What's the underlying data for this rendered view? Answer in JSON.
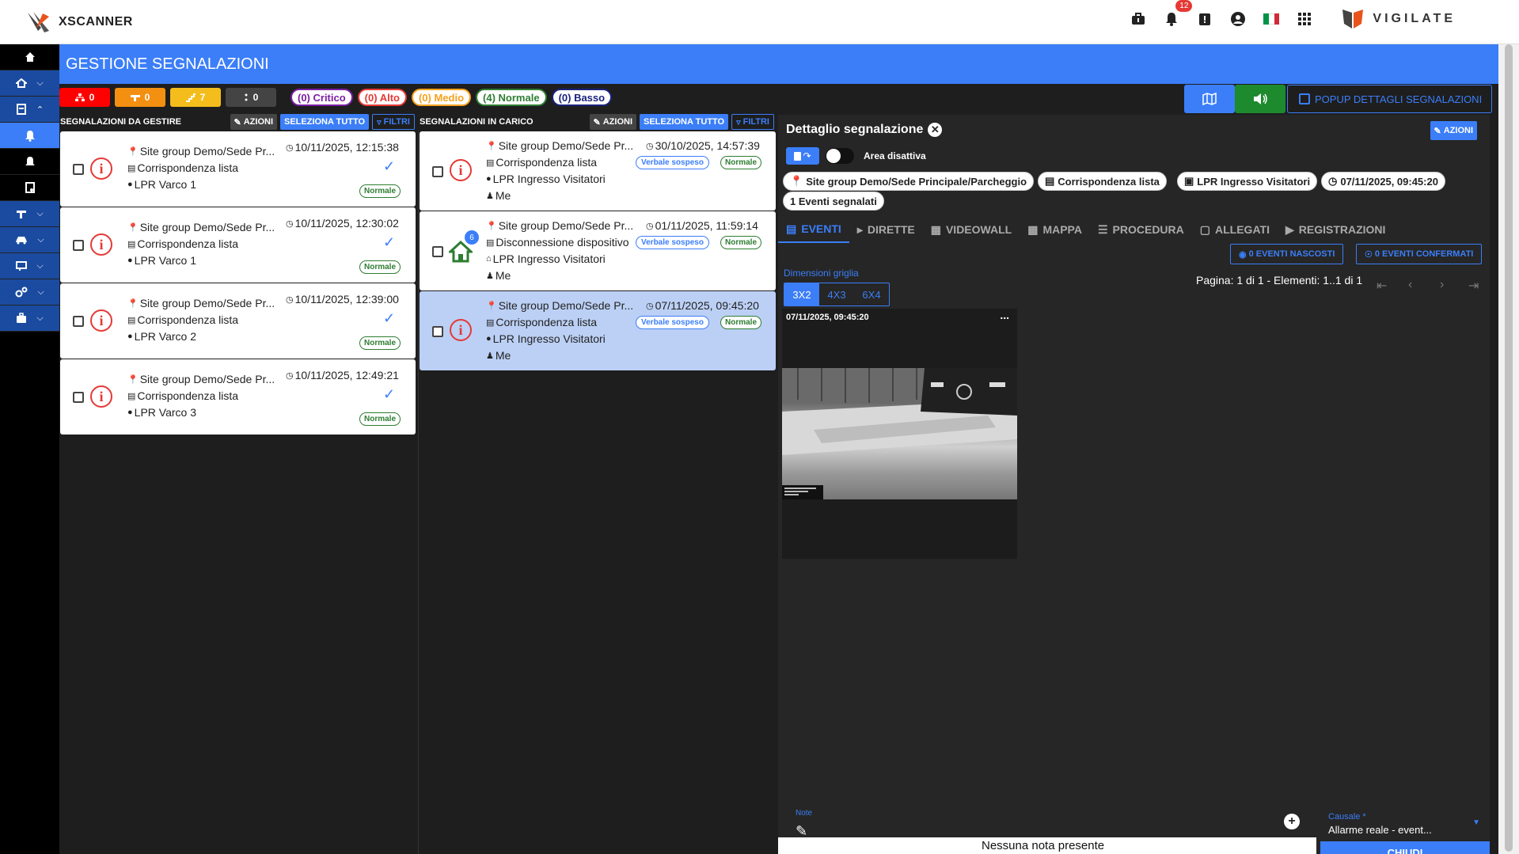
{
  "app": {
    "name": "XSCANNER",
    "brand": "VIGILATE",
    "notification_count": "12"
  },
  "page": {
    "title": "GESTIONE SEGNALAZIONI"
  },
  "severity_counts": [
    {
      "value": "0",
      "color": "#ff0000"
    },
    {
      "value": "0",
      "color": "#f39011"
    },
    {
      "value": "7",
      "color": "#f4bd1c"
    },
    {
      "value": "0",
      "color": "#444444"
    }
  ],
  "filter_pills": [
    {
      "label": "(0) Critico",
      "color": "#7b1fa2"
    },
    {
      "label": "(0) Alto",
      "color": "#e53935"
    },
    {
      "label": "(0) Medio",
      "color": "#f4a21c"
    },
    {
      "label": "(4) Normale",
      "color": "#2e7d32"
    },
    {
      "label": "(0) Basso",
      "color": "#1a237e"
    }
  ],
  "toolbar": {
    "popup_label": "POPUP DETTAGLI SEGNALAZIONI"
  },
  "col_left": {
    "title": "SEGNALAZIONI DA GESTIRE",
    "azioni": "AZIONI",
    "seleziona": "SELEZIONA TUTTO",
    "filtri": "FILTRI",
    "cards": [
      {
        "site": "Site group Demo/Sede Pr...",
        "date": "10/11/2025, 12:15:38",
        "type": "Corrispondenza lista",
        "gate": "LPR Varco 1",
        "priority": "Normale"
      },
      {
        "site": "Site group Demo/Sede Pr...",
        "date": "10/11/2025, 12:30:02",
        "type": "Corrispondenza lista",
        "gate": "LPR Varco 1",
        "priority": "Normale"
      },
      {
        "site": "Site group Demo/Sede Pr...",
        "date": "10/11/2025, 12:39:00",
        "type": "Corrispondenza lista",
        "gate": "LPR Varco 2",
        "priority": "Normale"
      },
      {
        "site": "Site group Demo/Sede Pr...",
        "date": "10/11/2025, 12:49:21",
        "type": "Corrispondenza lista",
        "gate": "LPR Varco 3",
        "priority": "Normale"
      }
    ]
  },
  "col_mid": {
    "title": "SEGNALAZIONI IN CARICO",
    "azioni": "AZIONI",
    "seleziona": "SELEZIONA TUTTO",
    "filtri": "FILTRI",
    "cards": [
      {
        "site": "Site group Demo/Sede Pr...",
        "date": "30/10/2025, 14:57:39",
        "type": "Corrispondenza lista",
        "gate": "LPR Ingresso Visitatori",
        "user": "Me",
        "status": "Verbale sospeso",
        "priority": "Normale"
      },
      {
        "site": "Site group Demo/Sede Pr...",
        "date": "01/11/2025, 11:59:14",
        "type": "Disconnessione dispositivo",
        "gate": "LPR Ingresso Visitatori",
        "user": "Me",
        "status": "Verbale sospeso",
        "priority": "Normale",
        "count": "6"
      },
      {
        "site": "Site group Demo/Sede Pr...",
        "date": "07/11/2025, 09:45:20",
        "type": "Corrispondenza lista",
        "gate": "LPR Ingresso Visitatori",
        "user": "Me",
        "status": "Verbale sospeso",
        "priority": "Normale"
      }
    ]
  },
  "detail": {
    "title": "Dettaglio segnalazione",
    "azioni": "AZIONI",
    "area_label": "Area disattiva",
    "chips": {
      "site": "Site group Demo/Sede Principale/Parcheggio",
      "type": "Corrispondenza lista",
      "gate": "LPR Ingresso Visitatori",
      "date": "07/11/2025, 09:45:20",
      "events": "1 Eventi segnalati"
    },
    "tabs": [
      "EVENTI",
      "DIRETTE",
      "VIDEOWALL",
      "MAPPA",
      "PROCEDURA",
      "ALLEGATI",
      "REGISTRAZIONI"
    ],
    "hidden_events": "0 EVENTI NASCOSTI",
    "confirmed_events": "0 EVENTI CONFERMATI",
    "grid_label": "Dimensioni griglia",
    "grid_options": [
      "3X2",
      "4X3",
      "6X4"
    ],
    "pagination": "Pagina: 1 di 1 - Elementi: 1..1 di 1",
    "event": {
      "timestamp": "07/11/2025, 09:45:20",
      "more": "..."
    },
    "note_label": "Note",
    "no_notes": "Nessuna nota presente",
    "causale_label": "Causale *",
    "causale_value": "Allarme reale - event...",
    "close_button": "CHIUDI"
  }
}
